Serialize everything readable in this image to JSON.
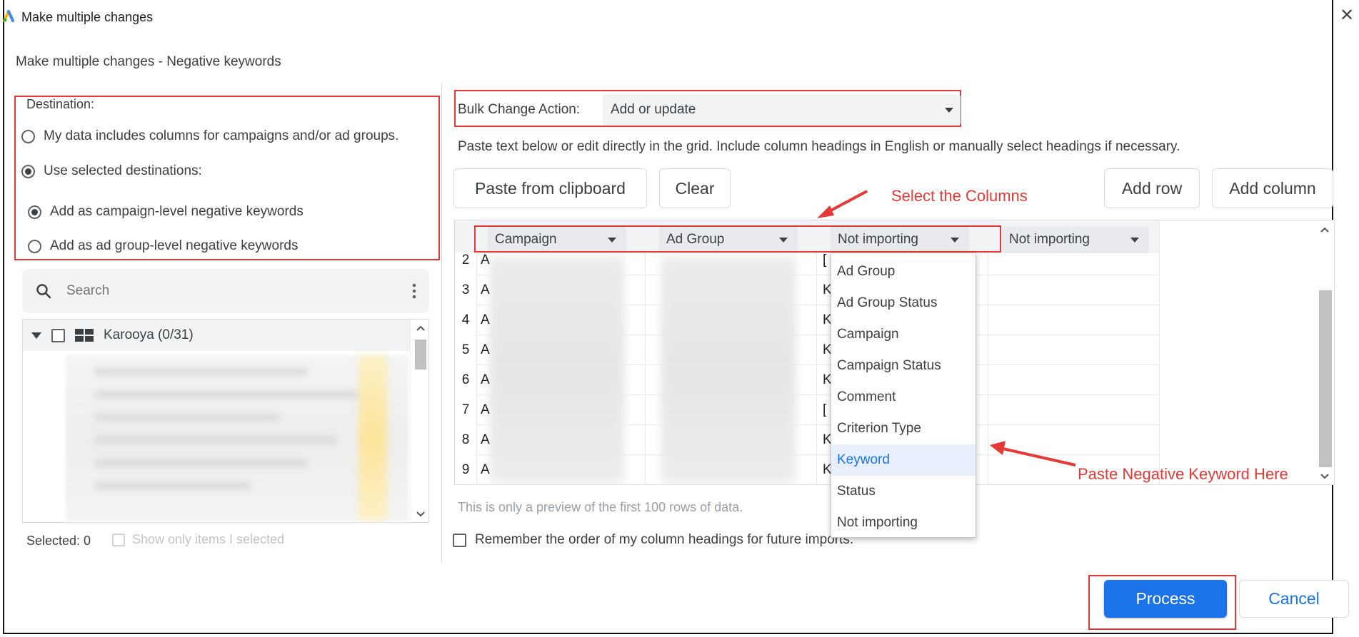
{
  "window": {
    "title": "Make multiple changes",
    "close_glyph": "✕"
  },
  "dialog": {
    "title": "Make multiple changes - Negative keywords"
  },
  "destination": {
    "label": "Destination:",
    "option_columns": "My data includes columns for campaigns and/or ad groups.",
    "option_selected": "Use selected destinations:",
    "option_campaign_level": "Add as campaign-level negative keywords",
    "option_adgroup_level": "Add as ad group-level negative keywords",
    "selected_option": "option_selected",
    "selected_level": "option_campaign_level"
  },
  "search": {
    "placeholder": "Search"
  },
  "tree": {
    "root_label": "Karooya (0/31)"
  },
  "selection": {
    "count_label": "Selected: 0",
    "show_only_label": "Show only items I selected"
  },
  "bulk": {
    "label": "Bulk Change Action:",
    "value": "Add or update"
  },
  "hint": "Paste text below or edit directly in the grid. Include column headings in English or manually select headings if necessary.",
  "toolbar": {
    "paste": "Paste from clipboard",
    "clear": "Clear",
    "add_row": "Add row",
    "add_column": "Add column"
  },
  "grid": {
    "columns": [
      "Campaign",
      "Ad Group",
      "Not importing",
      "Not importing"
    ],
    "row_numbers": [
      "2",
      "3",
      "4",
      "5",
      "6",
      "7",
      "8",
      "9"
    ],
    "col1_letters": [
      "A",
      "A",
      "A",
      "A",
      "A",
      "A",
      "A",
      "A"
    ],
    "col3_letters": [
      "[",
      "K",
      "K",
      "K",
      "K",
      "[",
      "K",
      "K"
    ]
  },
  "dropdown": {
    "items": [
      "Ad Group",
      "Ad Group Status",
      "Campaign",
      "Campaign Status",
      "Comment",
      "Criterion Type",
      "Keyword",
      "Status",
      "Not importing"
    ],
    "highlighted": "Keyword"
  },
  "preview_note": "This is only a preview of the first 100 rows of data.",
  "remember_label": "Remember the order of my column headings for future imports.",
  "annotations": {
    "select_columns": "Select the Columns",
    "paste_keyword": "Paste Negative Keyword Here",
    "color": "#e53935"
  },
  "footer": {
    "process": "Process",
    "cancel": "Cancel"
  },
  "colors": {
    "primary": "#1a73e8",
    "highlight_bg": "#e8f0fe",
    "panel_bg": "#f1f3f4"
  }
}
